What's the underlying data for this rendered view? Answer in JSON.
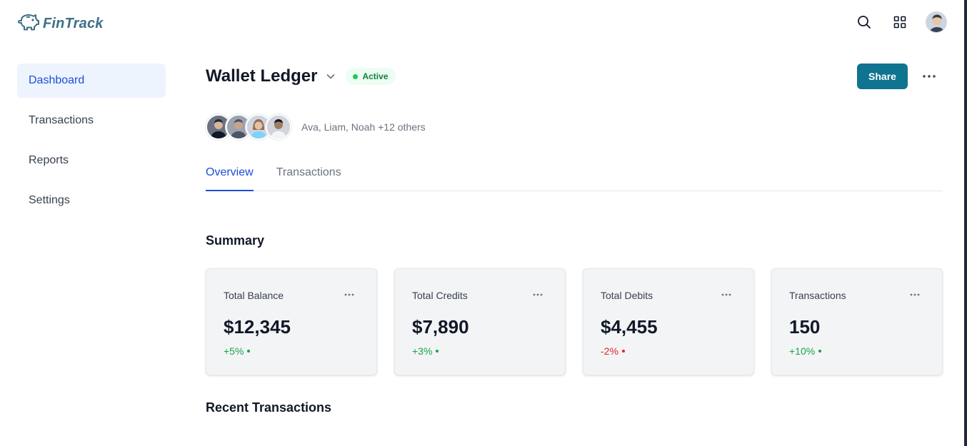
{
  "app": {
    "name": "FinTrack"
  },
  "colors": {
    "brand": "#3f6f86",
    "accent": "#1d4ed8",
    "primary_button": "#0e7490",
    "positive": "#16a34a",
    "negative": "#dc2626",
    "active_status": "#22c55e"
  },
  "header": {
    "icons": [
      "search-icon",
      "grid-icon",
      "user-avatar"
    ]
  },
  "sidebar": {
    "items": [
      {
        "label": "Dashboard",
        "active": true
      },
      {
        "label": "Transactions",
        "active": false
      },
      {
        "label": "Reports",
        "active": false
      },
      {
        "label": "Settings",
        "active": false
      }
    ]
  },
  "ledger": {
    "title": "Wallet Ledger",
    "status": "Active",
    "share_label": "Share",
    "members_text": "Ava, Liam, Noah +12 others"
  },
  "tabs": [
    {
      "label": "Overview",
      "active": true
    },
    {
      "label": "Transactions",
      "active": false
    }
  ],
  "summary": {
    "title": "Summary",
    "cards": [
      {
        "label": "Total Balance",
        "value": "$12,345",
        "change": "+5%",
        "trend": "positive"
      },
      {
        "label": "Total Credits",
        "value": "$7,890",
        "change": "+3%",
        "trend": "positive"
      },
      {
        "label": "Total Debits",
        "value": "$4,455",
        "change": "-2%",
        "trend": "negative"
      },
      {
        "label": "Transactions",
        "value": "150",
        "change": "+10%",
        "trend": "positive"
      }
    ]
  },
  "recent": {
    "title": "Recent Transactions"
  }
}
